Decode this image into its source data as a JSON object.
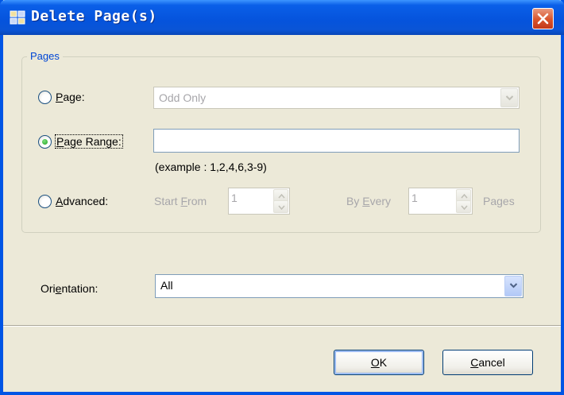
{
  "window": {
    "title": "Delete Page(s)"
  },
  "pages_group": {
    "legend": "Pages",
    "page_option": {
      "label_prefix": "",
      "mnemonic": "P",
      "label_rest": "age:",
      "selected": false
    },
    "page_combo": {
      "value": "Odd Only",
      "enabled": false
    },
    "range_option": {
      "mnemonic": "P",
      "label_rest": "age Range:",
      "selected": true,
      "label_mnemonic_index": 0
    },
    "range_input": {
      "value": ""
    },
    "range_hint": "(example : 1,2,4,6,3-9)",
    "advanced_option": {
      "mnemonic": "A",
      "label_rest": "dvanced:",
      "selected": false
    },
    "start_from": {
      "label_prefix": "Start ",
      "mnemonic": "F",
      "label_rest": "rom",
      "value": "1"
    },
    "by_every": {
      "label_prefix": "By ",
      "mnemonic": "E",
      "label_rest": "very",
      "value": "1",
      "suffix": "Pages"
    }
  },
  "orientation": {
    "label_prefix": "Ori",
    "mnemonic": "e",
    "label_rest": "ntation:",
    "value": "All"
  },
  "buttons": {
    "ok": {
      "mnemonic": "O",
      "label_rest": "K"
    },
    "cancel": {
      "mnemonic": "C",
      "label_rest": "ancel"
    }
  },
  "colors": {
    "title_bar": "#0553dc",
    "legend": "#0046d5",
    "dialog_bg": "#ece9d8",
    "radio_selected": "#21a121"
  }
}
